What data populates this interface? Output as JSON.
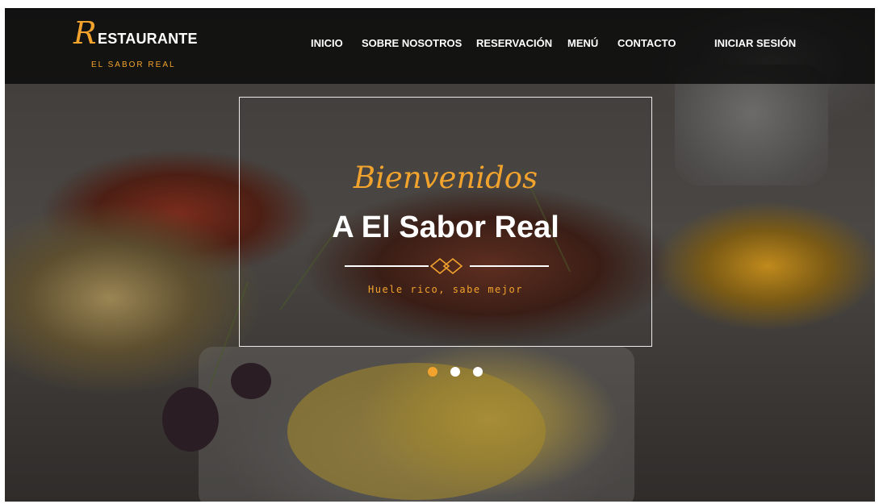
{
  "brand": {
    "logo_initial": "R",
    "logo_rest": "ESTAURANTE",
    "tagline": "EL SABOR REAL",
    "accent_color": "#f2a32d"
  },
  "nav": {
    "items": [
      {
        "label": "INICIO"
      },
      {
        "label": "SOBRE NOSOTROS"
      },
      {
        "label": "RESERVACIÓN"
      },
      {
        "label": "MENÚ"
      },
      {
        "label": "CONTACTO"
      },
      {
        "label": "INICIAR SESIÓN"
      }
    ]
  },
  "hero": {
    "script_title": "Bienvenidos",
    "title": "A El Sabor Real",
    "subtitle": "Huele rico, sabe mejor",
    "ornament_icon": "diamond-ornament-icon",
    "background_image": "food-platter-photo"
  },
  "carousel": {
    "slide_count": 3,
    "active_index": 0,
    "active_color": "#f2a32d",
    "inactive_color": "#ffffff"
  }
}
